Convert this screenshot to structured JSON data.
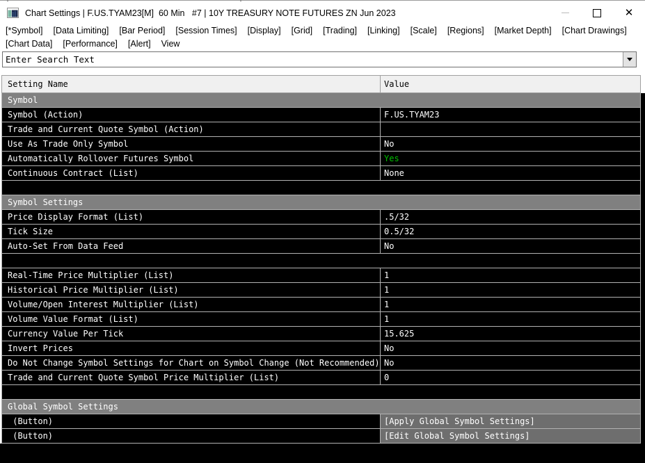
{
  "window": {
    "title": "Chart Settings | F.US.TYAM23[M]  60 Min   #7 | 10Y TREASURY NOTE FUTURES ZN Jun 2023"
  },
  "menu": {
    "line1": [
      "[*Symbol]",
      "[Data Limiting]",
      "[Bar Period]",
      "[Session Times]",
      "[Display]",
      "[Grid]",
      "[Trading]",
      "[Linking]",
      "[Scale]",
      "[Regions]",
      "[Market Depth]",
      "[Chart Drawings]"
    ],
    "line2": [
      "[Chart Data]",
      "[Performance]",
      "[Alert]",
      "View"
    ]
  },
  "search": {
    "value": "Enter Search Text"
  },
  "table": {
    "columns": {
      "name": "Setting Name",
      "value": "Value"
    },
    "rows": [
      {
        "type": "section",
        "name": "Symbol"
      },
      {
        "name": "Symbol (Action)",
        "value": "F.US.TYAM23"
      },
      {
        "name": "Trade and Current Quote Symbol (Action)",
        "value": ""
      },
      {
        "name": "Use As Trade Only Symbol",
        "value": "No"
      },
      {
        "name": "Automatically Rollover Futures Symbol",
        "value": "Yes",
        "value_color": "#00c000"
      },
      {
        "name": "Continuous Contract (List)",
        "value": "None"
      },
      {
        "type": "separator"
      },
      {
        "type": "section",
        "name": "Symbol Settings"
      },
      {
        "name": "Price Display Format (List)",
        "value": ".5/32"
      },
      {
        "name": "Tick Size",
        "value": "0.5/32"
      },
      {
        "name": "Auto-Set From Data Feed",
        "value": "No"
      },
      {
        "type": "separator"
      },
      {
        "name": "Real-Time Price Multiplier (List)",
        "value": "1"
      },
      {
        "name": "Historical Price Multiplier (List)",
        "value": "1"
      },
      {
        "name": "Volume/Open Interest Multiplier (List)",
        "value": "1"
      },
      {
        "name": "Volume Value Format (List)",
        "value": "1"
      },
      {
        "name": "Currency Value Per Tick",
        "value": "15.625"
      },
      {
        "name": "Invert Prices",
        "value": "No"
      },
      {
        "name": "Do Not Change Symbol Settings for Chart on Symbol Change (Not Recommended)",
        "value": "No"
      },
      {
        "name": "Trade and Current Quote Symbol Price Multiplier (List)",
        "value": "0"
      },
      {
        "type": "separator"
      },
      {
        "type": "section",
        "name": "Global Symbol Settings"
      },
      {
        "name": " (Button)",
        "value": "[Apply Global Symbol Settings]",
        "button": true
      },
      {
        "name": " (Button)",
        "value": "[Edit Global Symbol Settings]",
        "button": true
      }
    ]
  },
  "colors": {
    "green": "#00c000",
    "section_bg": "#808080",
    "button_cell_bg": "#6e6e6e",
    "row_bg": "#000000",
    "row_text": "#ffffff",
    "header_bg": "#f0f0f0"
  }
}
